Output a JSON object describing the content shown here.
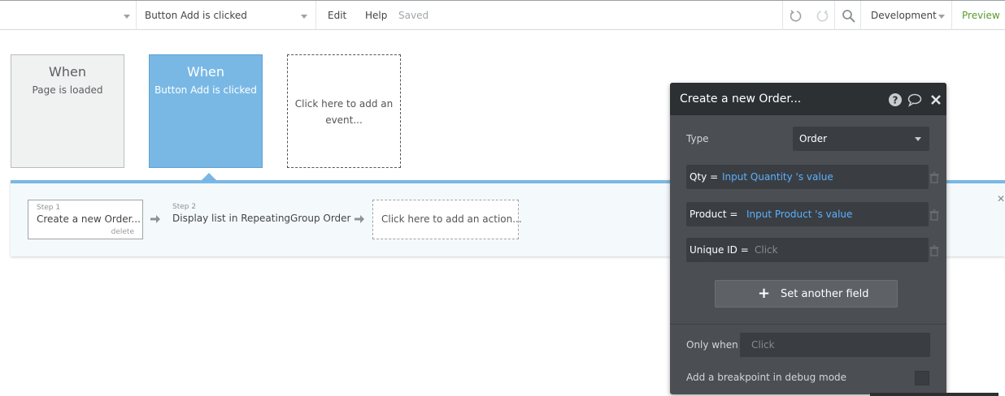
{
  "topbar": {
    "event_select": "Button Add is clicked",
    "menu_edit": "Edit",
    "menu_help": "Help",
    "status": "Saved",
    "environment": "Development",
    "preview": "Preview"
  },
  "events": [
    {
      "title": "When",
      "subtitle": "Page is loaded"
    },
    {
      "title": "When",
      "subtitle": "Button Add is clicked"
    }
  ],
  "add_event_text": "Click here to add an event...",
  "actions": {
    "steps": [
      {
        "label": "Step 1",
        "name": "Create a new Order...",
        "delete": "delete"
      },
      {
        "label": "Step 2",
        "name": "Display list in RepeatingGroup Order"
      }
    ],
    "add_action_text": "Click here to add an action..."
  },
  "panel": {
    "title": "Create a new Order...",
    "type_label": "Type",
    "type_value": "Order",
    "fields": [
      {
        "key": "Qty =",
        "value": "Input Quantity 's value"
      },
      {
        "key": "Product =",
        "value": "Input Product 's value"
      },
      {
        "key": "Unique ID =",
        "value": "Click"
      }
    ],
    "set_field_label": "Set another field",
    "only_when_label": "Only when",
    "only_when_value": "Click",
    "breakpoint_label": "Add a breakpoint in debug mode"
  },
  "colors": {
    "accent_blue": "#79b8e5",
    "panel_bg": "#4b4f53",
    "panel_header": "#2c3033",
    "dynamic_value": "#5cb0ff",
    "preview_green": "#5a9a2e"
  },
  "icons": [
    "undo-icon",
    "redo-icon",
    "search-icon",
    "help-icon",
    "comment-icon",
    "close-icon",
    "trash-icon",
    "arrow-right-icon",
    "plus-icon"
  ]
}
